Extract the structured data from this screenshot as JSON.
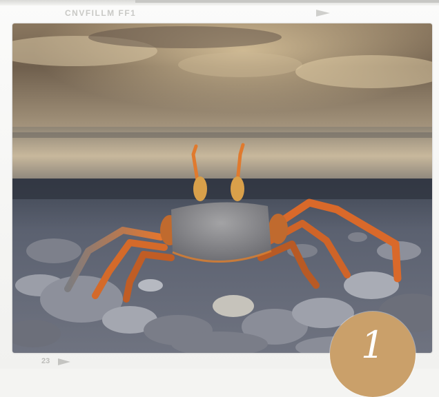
{
  "film": {
    "edge_code": "CNVFILLM FF1",
    "frame_number": "23"
  },
  "badge": {
    "number": "1"
  },
  "colors": {
    "frame": "#f4f4f2",
    "badge": "#caa06a",
    "sky": "#7d6a55",
    "sea": "#b9a98f",
    "pebbles": "#8e9099",
    "crab_body": "#8f8f91",
    "crab_legs": "#d9692a"
  },
  "icons": [
    "film-arrow-icon"
  ]
}
